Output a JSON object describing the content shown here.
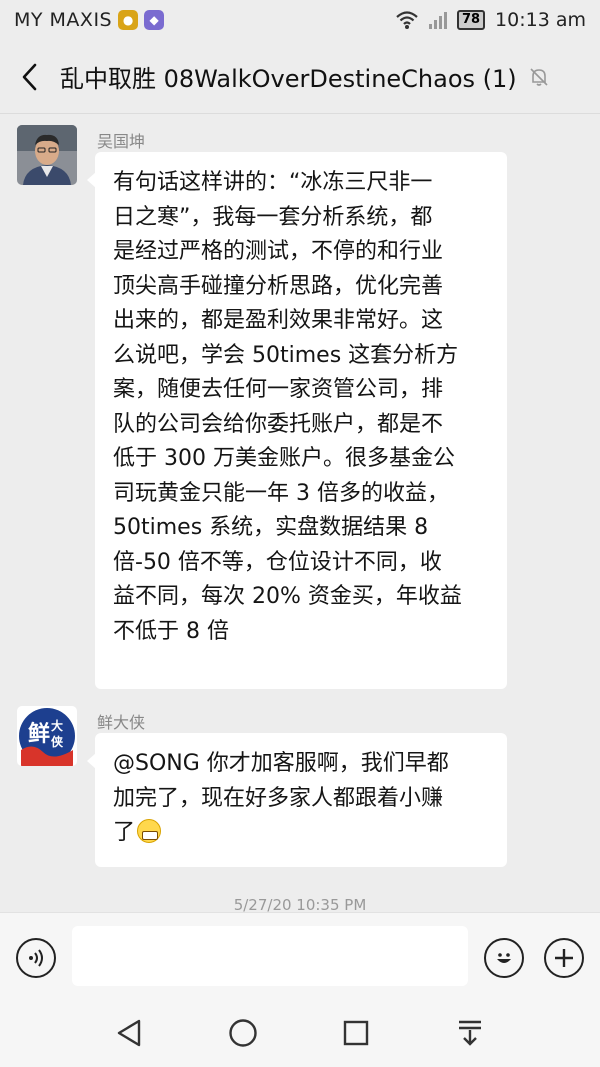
{
  "status_bar": {
    "carrier": "MY MAXIS",
    "battery": "78",
    "time": "10:13 am"
  },
  "header": {
    "title": "乱中取胜  08WalkOverDestineChaos (1)"
  },
  "messages": [
    {
      "sender": "吴国坤",
      "lines": [
        "有句话这样讲的：“冰冻三尺非一",
        "日之寒”，我每一套分析系统，都",
        "是经过严格的测试，不停的和行业",
        "顶尖高手碰撞分析思路，优化完善",
        "出来的，都是盈利效果非常好。这",
        "么说吧，学会 50times 这套分析方",
        "案，随便去任何一家资管公司，排",
        "队的公司会给你委托账户，都是不",
        "低于 300 万美金账户。很多基金公",
        "司玩黄金只能一年 3 倍多的收益，",
        "50times 系统，实盘数据结果 8",
        "倍-50 倍不等，仓位设计不同，收",
        "益不同，每次 20% 资金买，年收益",
        "不低于 8 倍"
      ]
    },
    {
      "sender": "鲜大侠",
      "lines": [
        "@SONG 你才加客服啊，我们早都",
        "加完了，现在好多家人都跟着小赚",
        "了"
      ],
      "emoji": "grinning-face"
    }
  ],
  "timestamp": "5/27/20 10:35 PM",
  "avatar2_text": "鲜大侠",
  "colors": {
    "background": "#ededed",
    "bubble": "#ffffff",
    "sender_name": "#888888"
  }
}
